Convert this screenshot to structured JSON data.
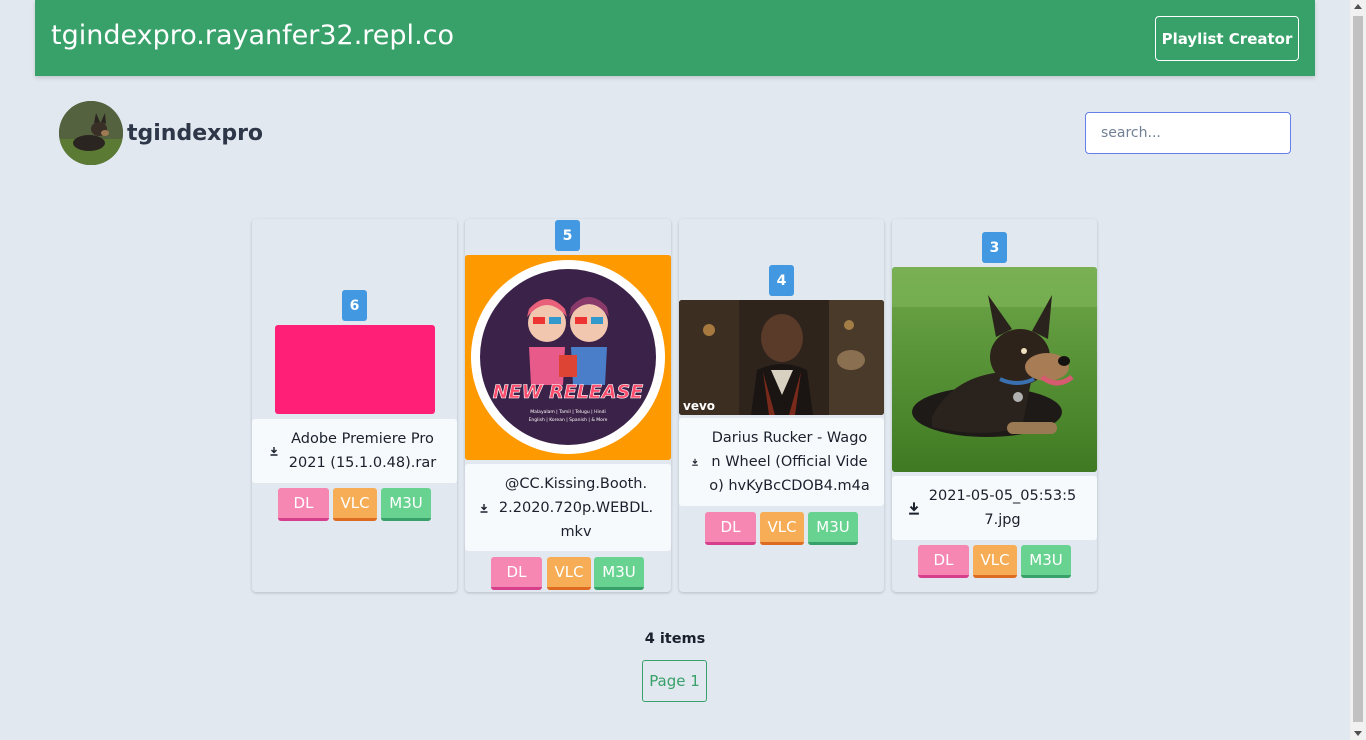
{
  "header": {
    "site_title": "tgindexpro.rayanfer32.repl.co",
    "playlist_button": "Playlist Creator"
  },
  "channel": {
    "name": "tgindexpro"
  },
  "search": {
    "placeholder": "search..."
  },
  "cards": [
    {
      "badge": "6",
      "filename": "Adobe Premiere Pro 2021 (15.1.0.48).rar",
      "thumb_color": "#ff1f76",
      "dl_label": "DL",
      "vlc_label": "VLC",
      "m3u_label": "M3U"
    },
    {
      "badge": "5",
      "filename": "@CC.Kissing.Booth.2.2020.720p.WEBDL.mkv",
      "thumb_text": "NEW RELEASE",
      "thumb_subtext": "Malayalam | Tamil | Telugu | Hindi",
      "thumb_subtext2": "English | Korean | Spanish | & More",
      "dl_label": "DL",
      "vlc_label": "VLC",
      "m3u_label": "M3U"
    },
    {
      "badge": "4",
      "filename": "Darius Rucker - Wagon Wheel (Official Video) hvKyBcCDOB4.m4a",
      "thumb_watermark": "vevo",
      "dl_label": "DL",
      "vlc_label": "VLC",
      "m3u_label": "M3U"
    },
    {
      "badge": "3",
      "filename": "2021-05-05_05:53:57.jpg",
      "dl_label": "DL",
      "vlc_label": "VLC",
      "m3u_label": "M3U"
    }
  ],
  "footer": {
    "items_count": "4 items",
    "page_label": "Page 1"
  },
  "colors": {
    "header_bg": "#38a169",
    "badge": "#4299e1",
    "dl": "#f687b3",
    "vlc": "#f6ad55",
    "m3u": "#68d391"
  }
}
